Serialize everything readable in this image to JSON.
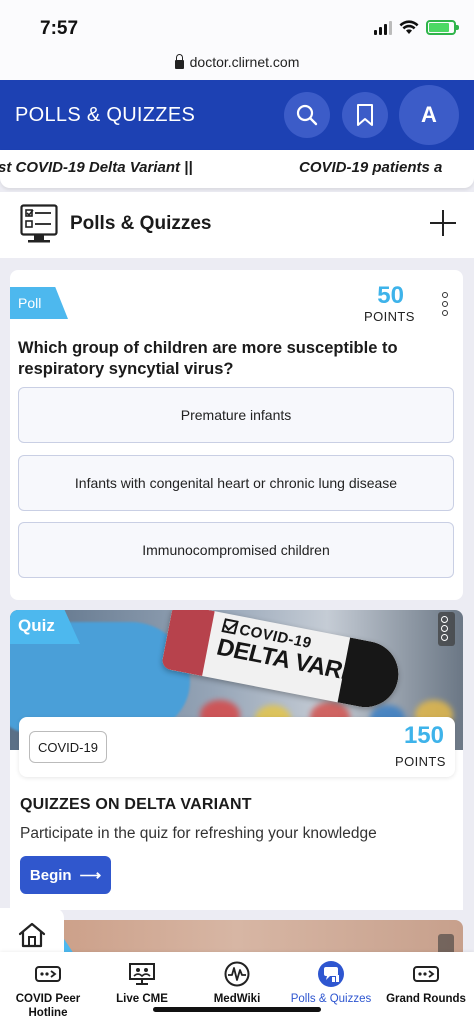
{
  "status_bar": {
    "time": "7:57",
    "battery_level": 0.85,
    "battery_color": "#4cd964"
  },
  "browser": {
    "url": "doctor.clirnet.com"
  },
  "header": {
    "title": "POLLS & QUIZZES",
    "avatar_initial": "A",
    "color": "#1d41b3"
  },
  "ticker": {
    "items": [
      "st COVID-19 Delta Variant ||",
      "COVID-19 patients a"
    ]
  },
  "section": {
    "title": "Polls & Quizzes"
  },
  "poll": {
    "tag": "Poll",
    "points": "50",
    "points_label": "POINTS",
    "question": "Which group of children are more susceptible to respiratory syncytial virus?",
    "options": [
      "Premature infants",
      "Infants with congenital heart or chronic lung disease",
      "Immunocompromised children"
    ]
  },
  "quiz": {
    "tag": "Quiz",
    "image_text_line1": "COVID-19",
    "image_text_line2": "DELTA VARIANT",
    "chip": "COVID-19",
    "points": "150",
    "points_label": "POINTS",
    "title": "QUIZZES ON DELTA VARIANT",
    "description": "Participate in the quiz for refreshing your knowledge",
    "button_label": "Begin",
    "button_arrow": "⟶"
  },
  "bottom_nav": {
    "items": [
      {
        "label": "COVID Peer Hotline",
        "icon": "phone-badge-icon"
      },
      {
        "label": "Live CME",
        "icon": "presentation-icon"
      },
      {
        "label": "MedWiki",
        "icon": "pulse-circle-icon"
      },
      {
        "label": "Polls & Quizzes",
        "icon": "quiz-bubble-icon",
        "active": true
      },
      {
        "label": "Grand Rounds",
        "icon": "phone-badge-icon"
      }
    ],
    "active_color": "#2e56d0"
  }
}
